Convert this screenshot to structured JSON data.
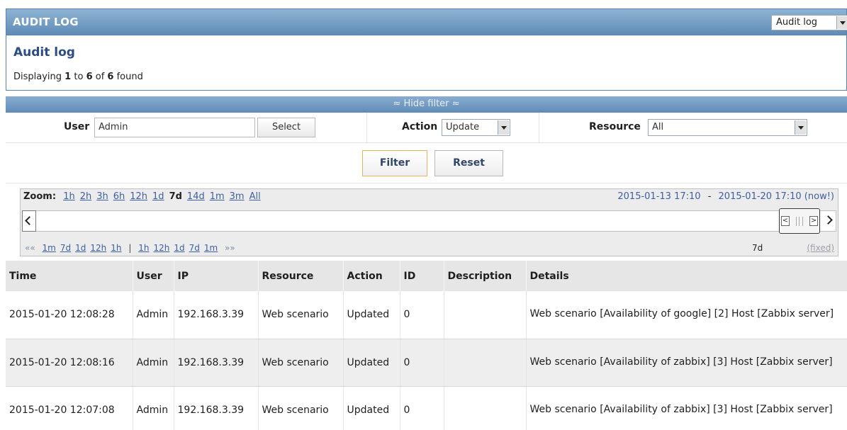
{
  "header": {
    "title": "AUDIT LOG",
    "view_select": "Audit log"
  },
  "page": {
    "title": "Audit log",
    "displaying_prefix": "Displaying",
    "from": "1",
    "to_word": "to",
    "to": "6",
    "of_word": "of",
    "total": "6",
    "found_word": "found"
  },
  "filter_toggle": "≈ Hide filter ≈",
  "filter": {
    "user_label": "User",
    "user_value": "Admin",
    "select_button": "Select",
    "action_label": "Action",
    "action_value": "Update",
    "resource_label": "Resource",
    "resource_value": "All",
    "filter_button": "Filter",
    "reset_button": "Reset"
  },
  "nav": {
    "zoom_label": "Zoom:",
    "zoom_options": [
      "1h",
      "2h",
      "3h",
      "6h",
      "12h",
      "1d",
      "7d",
      "14d",
      "1m",
      "3m",
      "All"
    ],
    "zoom_current": "7d",
    "period_from": "2015-01-13 17:10",
    "period_sep": "-",
    "period_to": "2015-01-20 17:10 (now!)",
    "back_arrows": "««",
    "back_links": [
      "1m",
      "7d",
      "1d",
      "12h",
      "1h"
    ],
    "divider": "|",
    "fwd_links": [
      "1h",
      "12h",
      "1d",
      "7d",
      "1m"
    ],
    "fwd_arrows": "»»",
    "period_length": "7d",
    "fixed_label": "(fixed)"
  },
  "table": {
    "columns": [
      "Time",
      "User",
      "IP",
      "Resource",
      "Action",
      "ID",
      "Description",
      "Details"
    ],
    "rows": [
      {
        "time": "2015-01-20 12:08:28",
        "user": "Admin",
        "ip": "192.168.3.39",
        "resource": "Web scenario",
        "action": "Updated",
        "id": "0",
        "description": "",
        "details": "Web scenario [Availability of google] [2] Host [Zabbix server]"
      },
      {
        "time": "2015-01-20 12:08:16",
        "user": "Admin",
        "ip": "192.168.3.39",
        "resource": "Web scenario",
        "action": "Updated",
        "id": "0",
        "description": "",
        "details": "Web scenario [Availability of zabbix] [3] Host [Zabbix server]"
      },
      {
        "time": "2015-01-20 12:07:08",
        "user": "Admin",
        "ip": "192.168.3.39",
        "resource": "Web scenario",
        "action": "Updated",
        "id": "0",
        "description": "",
        "details": "Web scenario [Availability of zabbix] [3] Host [Zabbix server]"
      }
    ]
  }
}
